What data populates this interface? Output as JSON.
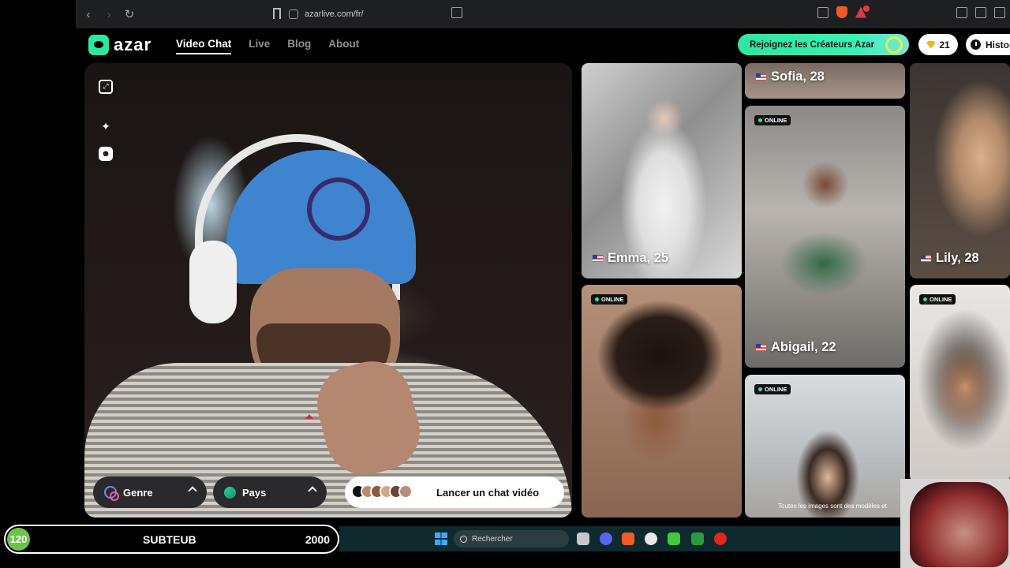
{
  "browser": {
    "url": "azarlive.com/fr/",
    "back_icon": "chevron-left-icon",
    "forward_icon": "chevron-right-icon",
    "reload_icon": "reload-icon"
  },
  "nav": {
    "logo_text": "azar",
    "menu": [
      "Video Chat",
      "Live",
      "Blog",
      "About"
    ],
    "active_menu": "Video Chat",
    "creator_button": "Rejoignez les Créateurs Azar",
    "gem_count": "21",
    "history_label": "Histor"
  },
  "video": {
    "tools": [
      "fullscreen-icon",
      "sparkle-effects-icon",
      "face-mask-icon"
    ],
    "genre_label": "Genre",
    "pays_label": "Pays",
    "start_label": "Lancer un chat vidéo"
  },
  "profiles": {
    "online_label": "ONLINE",
    "disclaimer": "Toutes les images sont des modèles et",
    "cards": [
      {
        "name": "Sofia, 28",
        "online": false
      },
      {
        "name": "Emma, 25",
        "online": false
      },
      {
        "name": "Abigail, 22",
        "online": true
      },
      {
        "name": "Lily, 28",
        "online": false
      },
      {
        "name": "",
        "online": true
      },
      {
        "name": "",
        "online": true
      },
      {
        "name": "",
        "online": true
      }
    ]
  },
  "overlay": {
    "counter_value": "120",
    "counter_name": "SUBTEUB",
    "counter_goal": "2000"
  },
  "taskbar": {
    "search_placeholder": "Rechercher"
  },
  "colors": {
    "accent": "#2fe6a0",
    "online_dot": "#2fe6a0",
    "gem": "#f3b41b"
  }
}
